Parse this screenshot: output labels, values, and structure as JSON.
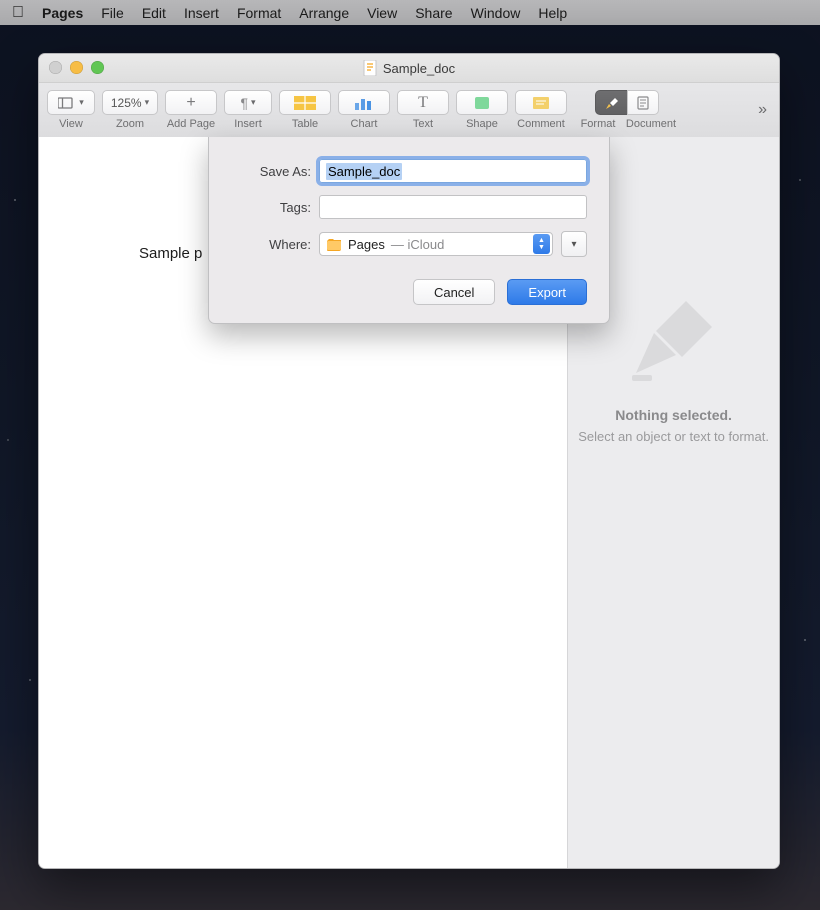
{
  "menubar": {
    "app": "Pages",
    "items": [
      "File",
      "Edit",
      "Insert",
      "Format",
      "Arrange",
      "View",
      "Share",
      "Window",
      "Help"
    ]
  },
  "window": {
    "title": "Sample_doc",
    "toolbar": {
      "view": "View",
      "zoom_value": "125%",
      "zoom_label": "Zoom",
      "add_page": "Add Page",
      "insert": "Insert",
      "table": "Table",
      "chart": "Chart",
      "text": "Text",
      "shape": "Shape",
      "comment": "Comment",
      "format": "Format",
      "document": "Document"
    }
  },
  "document": {
    "visible_text": "Sample p"
  },
  "inspector": {
    "nothing_title": "Nothing selected.",
    "nothing_hint": "Select an object or text to format."
  },
  "dialog": {
    "save_as_label": "Save As:",
    "save_as_value": "Sample_doc",
    "tags_label": "Tags:",
    "tags_value": "",
    "where_label": "Where:",
    "where_folder": "Pages",
    "where_location_suffix": " — iCloud",
    "cancel": "Cancel",
    "export": "Export"
  }
}
